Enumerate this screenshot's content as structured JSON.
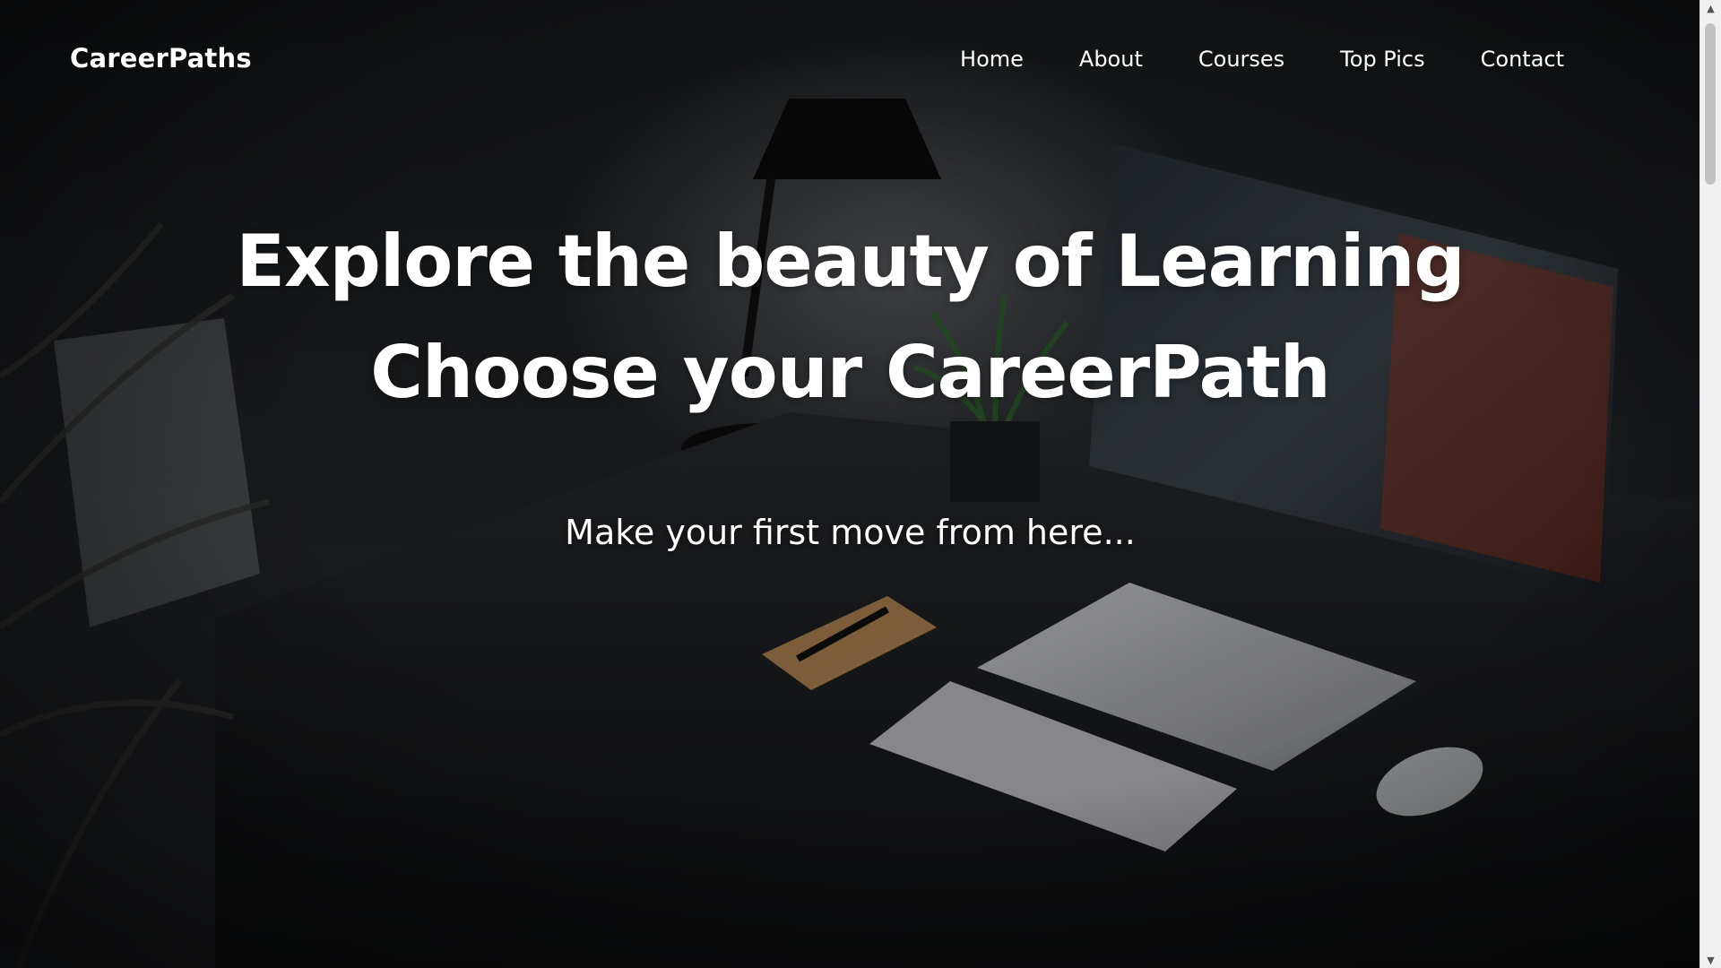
{
  "navbar": {
    "brand": "CareerPaths",
    "links": [
      {
        "label": "Home"
      },
      {
        "label": "About"
      },
      {
        "label": "Courses"
      },
      {
        "label": "Top Pics"
      },
      {
        "label": "Contact"
      }
    ]
  },
  "hero": {
    "line1": "Explore the beauty of Learning",
    "line2": "Choose your CareerPath",
    "subtitle": "Make your first move from here..."
  },
  "scrollbar": {
    "up_icon": "▲",
    "down_icon": "▼"
  }
}
